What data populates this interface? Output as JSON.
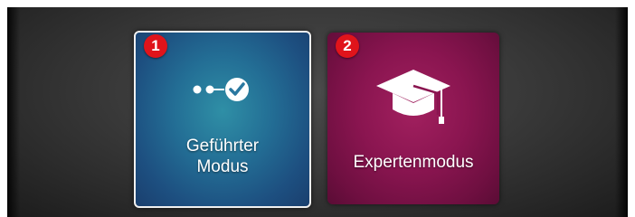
{
  "mode_selection": {
    "tiles": [
      {
        "badge": "1",
        "label": "Geführter\nModus",
        "icon": "guided-steps-check-icon",
        "selected": true,
        "color": "#236e95"
      },
      {
        "badge": "2",
        "label": "Expertenmodus",
        "icon": "graduation-cap-icon",
        "selected": false,
        "color": "#8a1550"
      }
    ],
    "badge_color": "#e0141b"
  }
}
